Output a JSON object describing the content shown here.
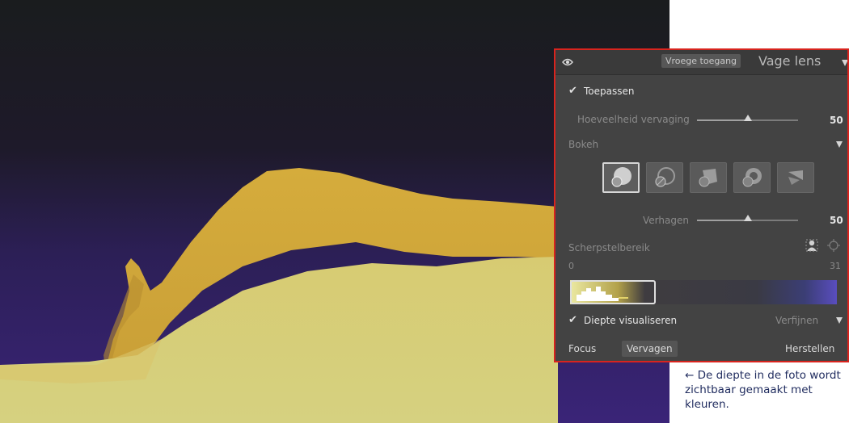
{
  "panel": {
    "early_access": "Vroege toegang",
    "title": "Vage lens",
    "apply_label": "Toepassen",
    "blur_amount_label": "Hoeveelheid vervaging",
    "blur_amount_value": "50",
    "blur_amount_level": 0.5,
    "bokeh_label": "Bokeh",
    "boost_label": "Verhagen",
    "boost_value": "50",
    "boost_level": 0.5,
    "focus_range_label": "Scherpstelbereik",
    "range_min": "0",
    "range_max": "31",
    "visualize_label": "Diepte visualiseren",
    "refine_label": "Verfijnen",
    "focus_button": "Focus",
    "blur_button": "Vervagen",
    "reset_button": "Herstellen"
  },
  "caption": {
    "arrow": "←",
    "text": "De diepte in de foto wordt zichtbaar gemaakt met kleuren."
  },
  "colors": {
    "panel_border": "#d8241e",
    "panel_bg": "#434343",
    "near_depth": "#d6bb4a",
    "far_depth": "#2a1f4e"
  }
}
